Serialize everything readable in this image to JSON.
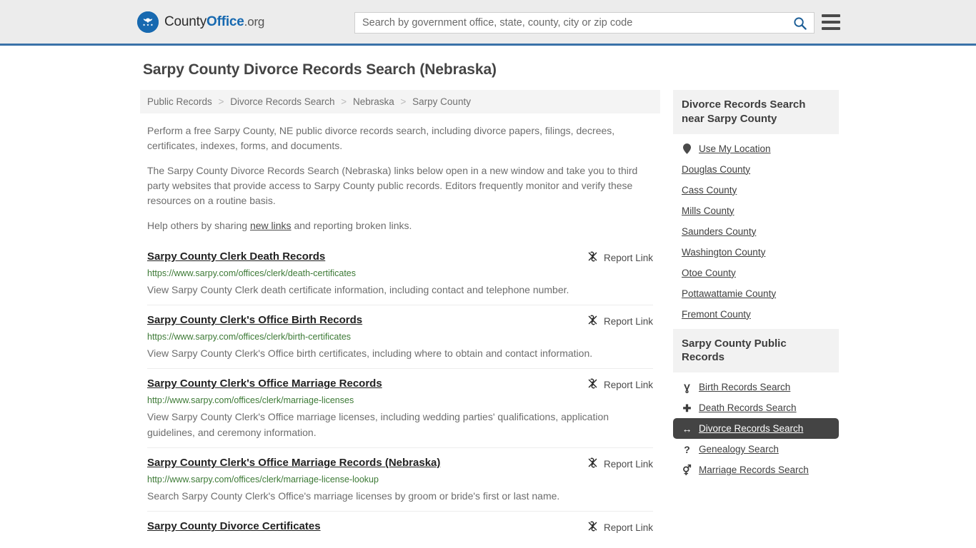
{
  "header": {
    "logo": {
      "part1": "County",
      "part2": "Office",
      "part3": ".org",
      "icon": "eagle-seal-icon"
    },
    "search": {
      "placeholder": "Search by government office, state, county, city or zip code",
      "value": "",
      "icon": "search-icon"
    },
    "menu_icon": "hamburger-menu-icon",
    "accent_color": "#3a72a8"
  },
  "page": {
    "title": "Sarpy County Divorce Records Search (Nebraska)"
  },
  "breadcrumb": {
    "separator": ">",
    "items": [
      {
        "label": "Public Records"
      },
      {
        "label": "Divorce Records Search"
      },
      {
        "label": "Nebraska"
      },
      {
        "label": "Sarpy County"
      }
    ]
  },
  "intro": {
    "p1": "Perform a free Sarpy County, NE public divorce records search, including divorce papers, filings, decrees, certificates, indexes, forms, and documents.",
    "p2": "The Sarpy County Divorce Records Search (Nebraska) links below open in a new window and take you to third party websites that provide access to Sarpy County public records. Editors frequently monitor and verify these resources on a routine basis.",
    "p3_before": "Help others by sharing ",
    "p3_link": "new links",
    "p3_after": " and reporting broken links."
  },
  "results": {
    "report_label": "Report Link",
    "report_icon": "broken-link-icon",
    "items": [
      {
        "title": "Sarpy County Clerk Death Records",
        "url": "https://www.sarpy.com/offices/clerk/death-certificates",
        "desc": "View Sarpy County Clerk death certificate information, including contact and telephone number."
      },
      {
        "title": "Sarpy County Clerk's Office Birth Records",
        "url": "https://www.sarpy.com/offices/clerk/birth-certificates",
        "desc": "View Sarpy County Clerk's Office birth certificates, including where to obtain and contact information."
      },
      {
        "title": "Sarpy County Clerk's Office Marriage Records",
        "url": "http://www.sarpy.com/offices/clerk/marriage-licenses",
        "desc": "View Sarpy County Clerk's Office marriage licenses, including wedding parties' qualifications, application guidelines, and ceremony information."
      },
      {
        "title": "Sarpy County Clerk's Office Marriage Records (Nebraska)",
        "url": "http://www.sarpy.com/offices/clerk/marriage-license-lookup",
        "desc": "Search Sarpy County Clerk's Office's marriage licenses by groom or bride's first or last name."
      },
      {
        "title": "Sarpy County Divorce Certificates",
        "url": "",
        "desc": ""
      }
    ]
  },
  "sidebar": {
    "panel_nearby": {
      "title": "Divorce Records Search near Sarpy County",
      "items": [
        {
          "label": "Use My Location",
          "icon": "map-pin-icon",
          "has_icon": true,
          "active": false
        },
        {
          "label": "Douglas County",
          "icon": "",
          "has_icon": false,
          "active": false
        },
        {
          "label": "Cass County",
          "icon": "",
          "has_icon": false,
          "active": false
        },
        {
          "label": "Mills County",
          "icon": "",
          "has_icon": false,
          "active": false
        },
        {
          "label": "Saunders County",
          "icon": "",
          "has_icon": false,
          "active": false
        },
        {
          "label": "Washington County",
          "icon": "",
          "has_icon": false,
          "active": false
        },
        {
          "label": "Otoe County",
          "icon": "",
          "has_icon": false,
          "active": false
        },
        {
          "label": "Pottawattamie County",
          "icon": "",
          "has_icon": false,
          "active": false
        },
        {
          "label": "Fremont County",
          "icon": "",
          "has_icon": false,
          "active": false
        }
      ]
    },
    "panel_public": {
      "title": "Sarpy County Public Records",
      "items": [
        {
          "label": "Birth Records Search",
          "icon": "baby-icon",
          "glyph": "Ɣ",
          "active": false
        },
        {
          "label": "Death Records Search",
          "icon": "cross-icon",
          "glyph": "✚",
          "active": false
        },
        {
          "label": "Divorce Records Search",
          "icon": "left-right-arrow-icon",
          "glyph": "↔",
          "active": true
        },
        {
          "label": "Genealogy Search",
          "icon": "question-mark-icon",
          "glyph": "?",
          "active": false
        },
        {
          "label": "Marriage Records Search",
          "icon": "male-female-icon",
          "glyph": "⚥",
          "active": false
        }
      ]
    }
  }
}
